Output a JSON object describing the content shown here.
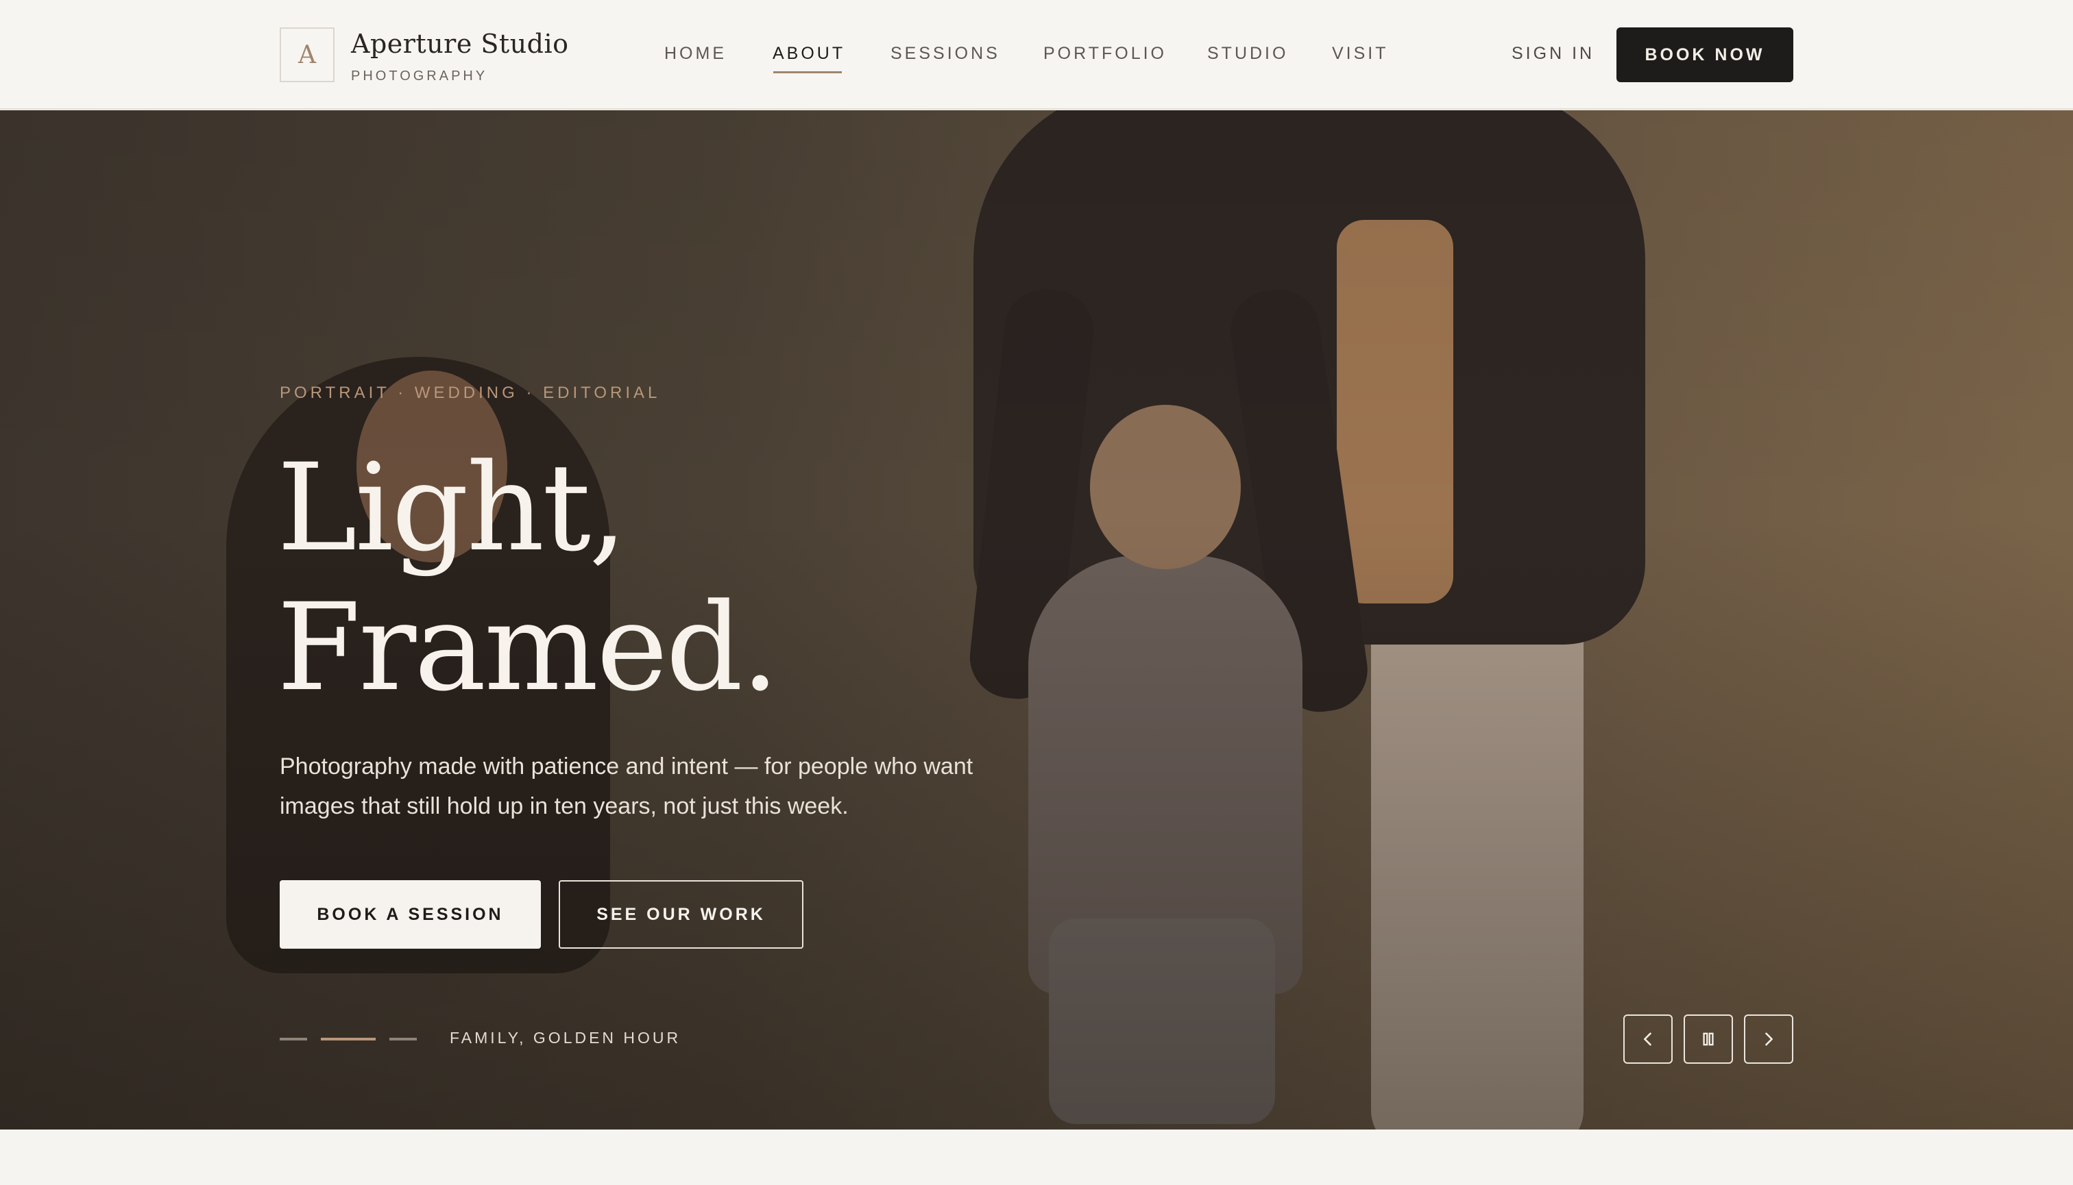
{
  "brand": {
    "monogram": "A",
    "name": "Aperture Studio",
    "tagline": "PHOTOGRAPHY"
  },
  "nav": {
    "items": [
      {
        "label": "HOME",
        "active": false
      },
      {
        "label": "ABOUT",
        "active": true
      },
      {
        "label": "SESSIONS",
        "active": false
      },
      {
        "label": "PORTFOLIO",
        "active": false
      },
      {
        "label": "STUDIO",
        "active": false
      },
      {
        "label": "VISIT",
        "active": false
      }
    ],
    "sign_in": "SIGN IN",
    "book_now": "BOOK NOW"
  },
  "hero": {
    "eyebrow": "PORTRAIT · WEDDING · EDITORIAL",
    "headline_line1": "Light,",
    "headline_line2": "Framed.",
    "lede": "Photography made with patience and intent — for people who want images that still hold up in ten years, not just this week.",
    "primary_cta": "BOOK A SESSION",
    "secondary_cta": "SEE OUR WORK",
    "slide_caption": "FAMILY, GOLDEN HOUR",
    "slide_count": 3,
    "active_slide": 2,
    "controls": {
      "prev_icon": "chevron-left-icon",
      "pause_icon": "pause-icon",
      "next_icon": "chevron-right-icon"
    }
  },
  "colors": {
    "accent": "#b9977a",
    "dark_button": "#1e1c1a",
    "header_bg": "#f7f5f2"
  }
}
